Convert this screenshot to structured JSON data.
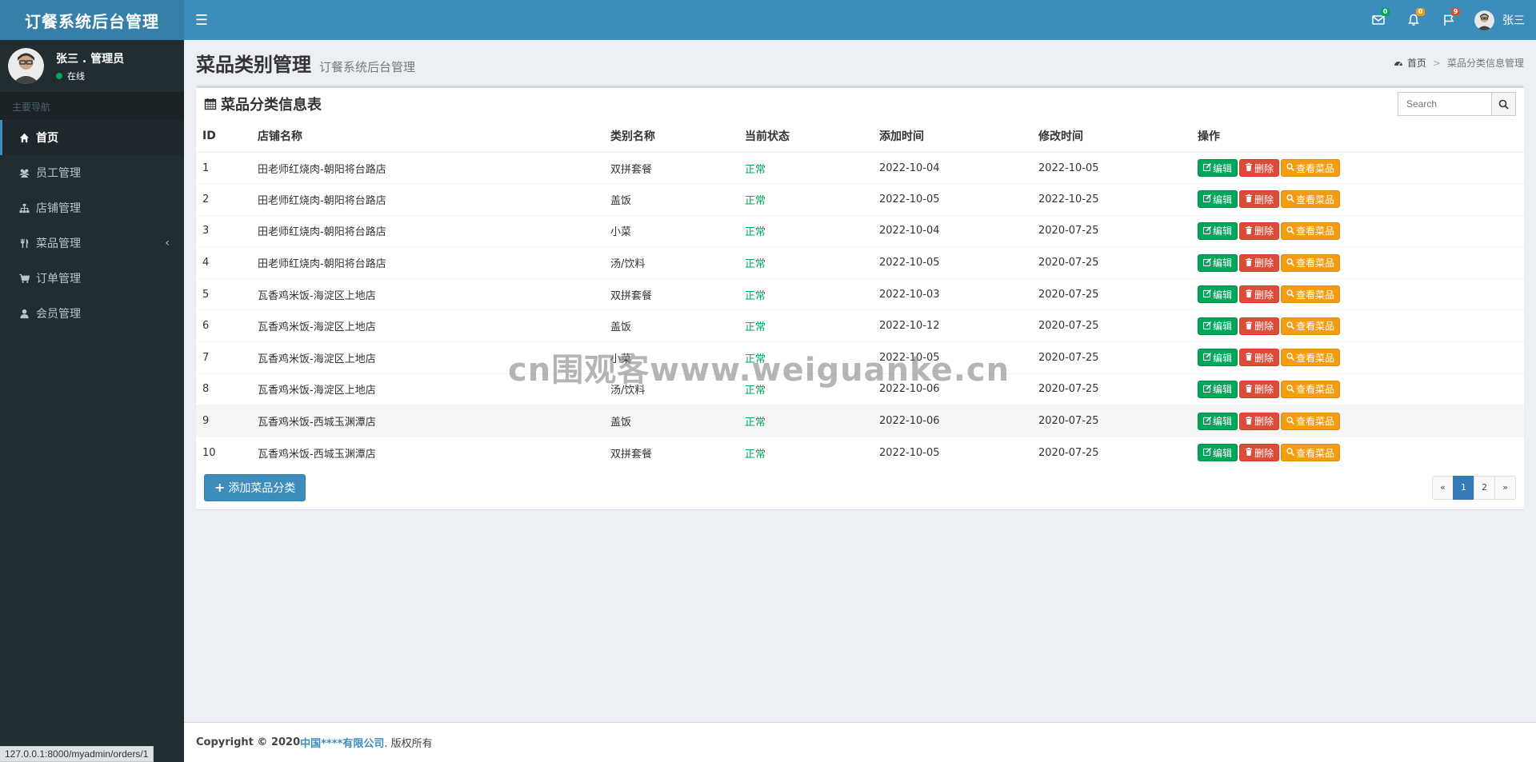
{
  "app": {
    "logo": "订餐系统后台管理"
  },
  "header": {
    "badges": {
      "mail": "0",
      "bell": "0",
      "flag": "9"
    },
    "user_name": "张三"
  },
  "sidebar": {
    "user_name": "张三 . 管理员",
    "user_status": "在线",
    "nav_header": "主要导航",
    "items": [
      {
        "label": "首页",
        "icon": "home-icon"
      },
      {
        "label": "员工管理",
        "icon": "users-icon"
      },
      {
        "label": "店铺管理",
        "icon": "sitemap-icon"
      },
      {
        "label": "菜品管理",
        "icon": "cutlery-icon"
      },
      {
        "label": "订单管理",
        "icon": "cart-icon"
      },
      {
        "label": "会员管理",
        "icon": "user-icon"
      }
    ]
  },
  "content": {
    "title": "菜品类别管理",
    "subtitle": "订餐系统后台管理",
    "breadcrumb": {
      "home": "首页",
      "current": "菜品分类信息管理"
    }
  },
  "box": {
    "title": "菜品分类信息表",
    "search_placeholder": "Search",
    "columns": [
      "ID",
      "店铺名称",
      "类别名称",
      "当前状态",
      "添加时间",
      "修改时间",
      "操作"
    ],
    "rows": [
      [
        "1",
        "田老师红烧肉-朝阳将台路店",
        "双拼套餐",
        "正常",
        "2022-10-04",
        "2022-10-05"
      ],
      [
        "2",
        "田老师红烧肉-朝阳将台路店",
        "盖饭",
        "正常",
        "2022-10-05",
        "2022-10-25"
      ],
      [
        "3",
        "田老师红烧肉-朝阳将台路店",
        "小菜",
        "正常",
        "2022-10-04",
        "2020-07-25"
      ],
      [
        "4",
        "田老师红烧肉-朝阳将台路店",
        "汤/饮料",
        "正常",
        "2022-10-05",
        "2020-07-25"
      ],
      [
        "5",
        "瓦香鸡米饭-海淀区上地店",
        "双拼套餐",
        "正常",
        "2022-10-03",
        "2020-07-25"
      ],
      [
        "6",
        "瓦香鸡米饭-海淀区上地店",
        "盖饭",
        "正常",
        "2022-10-12",
        "2020-07-25"
      ],
      [
        "7",
        "瓦香鸡米饭-海淀区上地店",
        "小菜",
        "正常",
        "2022-10-05",
        "2020-07-25"
      ],
      [
        "8",
        "瓦香鸡米饭-海淀区上地店",
        "汤/饮料",
        "正常",
        "2022-10-06",
        "2020-07-25"
      ],
      [
        "9",
        "瓦香鸡米饭-西城玉渊潭店",
        "盖饭",
        "正常",
        "2022-10-06",
        "2020-07-25"
      ],
      [
        "10",
        "瓦香鸡米饭-西城玉渊潭店",
        "双拼套餐",
        "正常",
        "2022-10-05",
        "2020-07-25"
      ]
    ],
    "actions": {
      "edit": "编辑",
      "delete": "删除",
      "view": "查看菜品"
    },
    "add_button": "添加菜品分类",
    "pager": [
      "«",
      "1",
      "2",
      "»"
    ]
  },
  "footer": {
    "prefix": "Copyright © 2020 ",
    "company": "中国****有限公司",
    "suffix": ". 版权所有"
  },
  "watermark": "cn围观客www.weiguanke.cn",
  "status_url": "127.0.0.1:8000/myadmin/orders/1",
  "colors": {
    "header": "#3c8dbc",
    "logo_bg": "#367fa9",
    "sidebar": "#222d32",
    "success": "#00a65a",
    "danger": "#dd4b39",
    "warning": "#f39c12"
  }
}
